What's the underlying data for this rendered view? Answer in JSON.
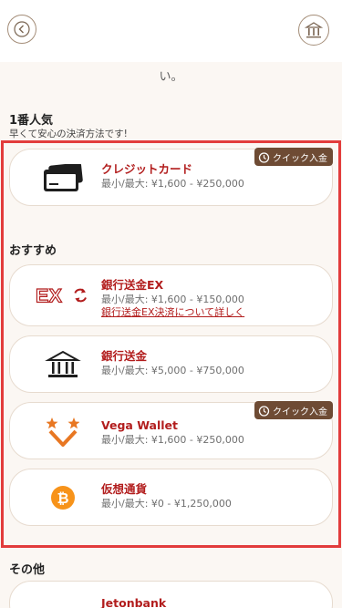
{
  "header": {
    "back_icon": "chevron-left-icon",
    "home_icon": "bank-home-icon"
  },
  "fragment_text": "い。",
  "popular": {
    "title": "1番人気",
    "subtitle": "早くて安心の決済方法です!"
  },
  "recommended_title": "おすすめ",
  "other_title": "その他",
  "badge_label": "クイック入金",
  "methods": [
    {
      "name": "クレジットカード",
      "range": "最小/最大: ¥1,600 - ¥250,000",
      "icon": "credit-card-icon",
      "badge": true
    },
    {
      "name": "銀行送金EX",
      "range": "最小/最大: ¥1,600 - ¥150,000",
      "link": "銀行送金EX決済について詳しく",
      "icon": "bank-transfer-ex-icon",
      "icon_text": "EX"
    },
    {
      "name": "銀行送金",
      "range": "最小/最大: ¥5,000 - ¥750,000",
      "icon": "bank-icon"
    },
    {
      "name": "Vega Wallet",
      "range": "最小/最大: ¥1,600 - ¥250,000",
      "icon": "vega-wallet-icon",
      "badge": true
    },
    {
      "name": "仮想通貨",
      "range": "最小/最大: ¥0 - ¥1,250,000",
      "icon": "bitcoin-icon"
    }
  ],
  "other_methods": [
    {
      "name": "Jetonbank"
    }
  ],
  "colors": {
    "accent": "#b21d1d",
    "badge": "#6e4b34",
    "highlight_frame": "#e23c3c",
    "background": "#fbf7f3"
  }
}
